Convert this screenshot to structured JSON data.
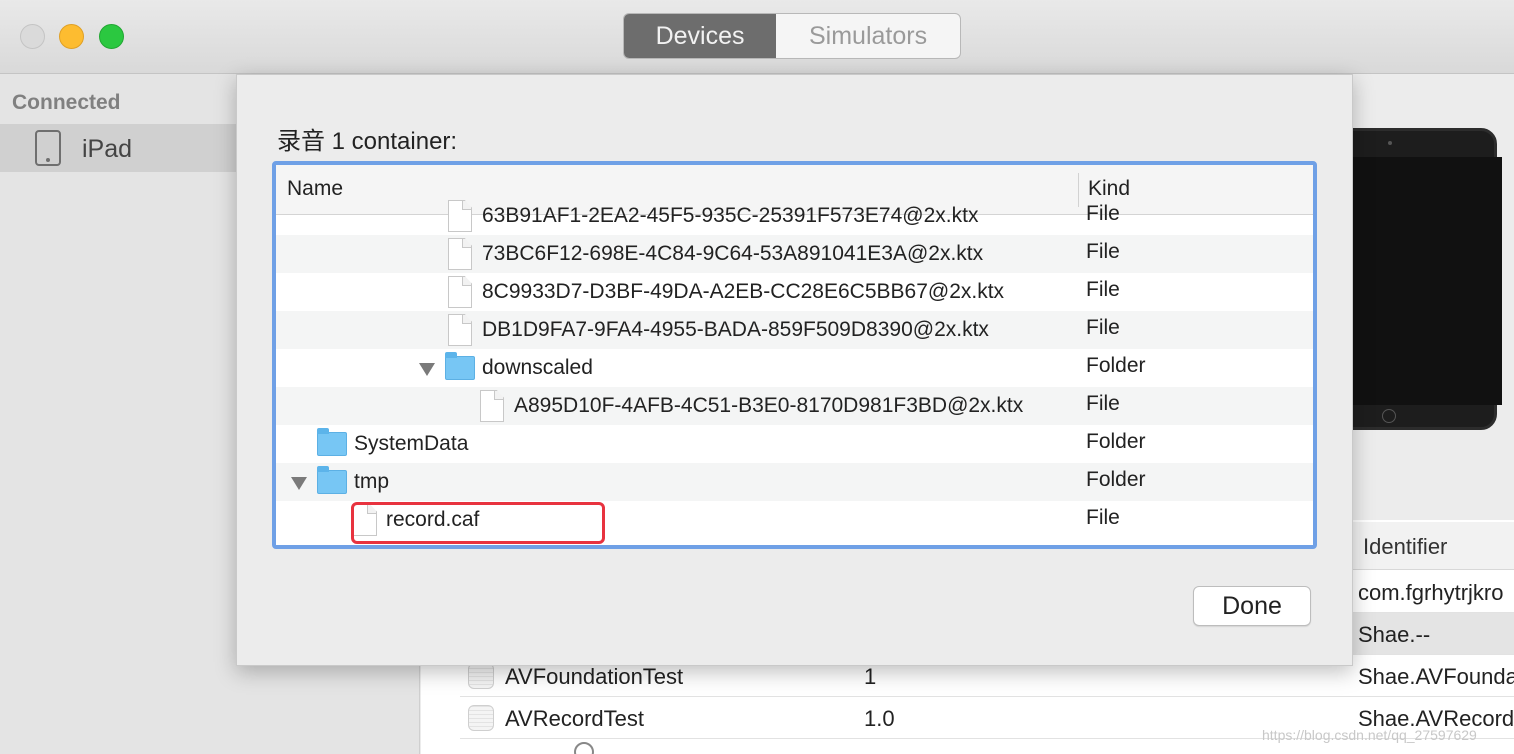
{
  "window": {
    "segments": [
      "Devices",
      "Simulators"
    ],
    "selected_segment": "Devices"
  },
  "sidebar": {
    "section_header": "Connected",
    "items": [
      {
        "label": "iPad",
        "icon": "ipad-icon"
      }
    ]
  },
  "background_apps": {
    "identifier_header": "Identifier",
    "rows": [
      {
        "name": "",
        "version": "",
        "identifier": "com.fgrhytrjkro"
      },
      {
        "name": "",
        "version": "",
        "identifier": "Shae.--"
      },
      {
        "name": "AVFoundationTest",
        "version": "1",
        "identifier": "Shae.AVFounda"
      },
      {
        "name": "AVRecordTest",
        "version": "1.0",
        "identifier": "Shae.AVRecord"
      }
    ],
    "watermark": "https://blog.csdn.net/qq_27597629"
  },
  "dialog": {
    "title": "录音 1 container:",
    "columns": {
      "name": "Name",
      "kind": "Kind"
    },
    "rows": [
      {
        "name": "63B91AF1-2EA2-45F5-935C-25391F573E74@2x.ktx",
        "kind": "File",
        "icon": "file-icon"
      },
      {
        "name": "73BC6F12-698E-4C84-9C64-53A891041E3A@2x.ktx",
        "kind": "File",
        "icon": "file-icon"
      },
      {
        "name": "8C9933D7-D3BF-49DA-A2EB-CC28E6C5BB67@2x.ktx",
        "kind": "File",
        "icon": "file-icon"
      },
      {
        "name": "DB1D9FA7-9FA4-4955-BADA-859F509D8390@2x.ktx",
        "kind": "File",
        "icon": "file-icon"
      },
      {
        "name": "downscaled",
        "kind": "Folder",
        "icon": "folder-icon",
        "expanded": true
      },
      {
        "name": "A895D10F-4AFB-4C51-B3E0-8170D981F3BD@2x.ktx",
        "kind": "File",
        "icon": "file-icon"
      },
      {
        "name": "SystemData",
        "kind": "Folder",
        "icon": "folder-icon"
      },
      {
        "name": "tmp",
        "kind": "Folder",
        "icon": "folder-icon",
        "expanded": true
      },
      {
        "name": "record.caf",
        "kind": "File",
        "icon": "file-icon",
        "highlighted": true
      }
    ],
    "done_label": "Done"
  },
  "colors": {
    "selection_focus_ring": "#6fa0e6",
    "highlight_box": "#e8333f",
    "folder": "#77c6f4"
  }
}
